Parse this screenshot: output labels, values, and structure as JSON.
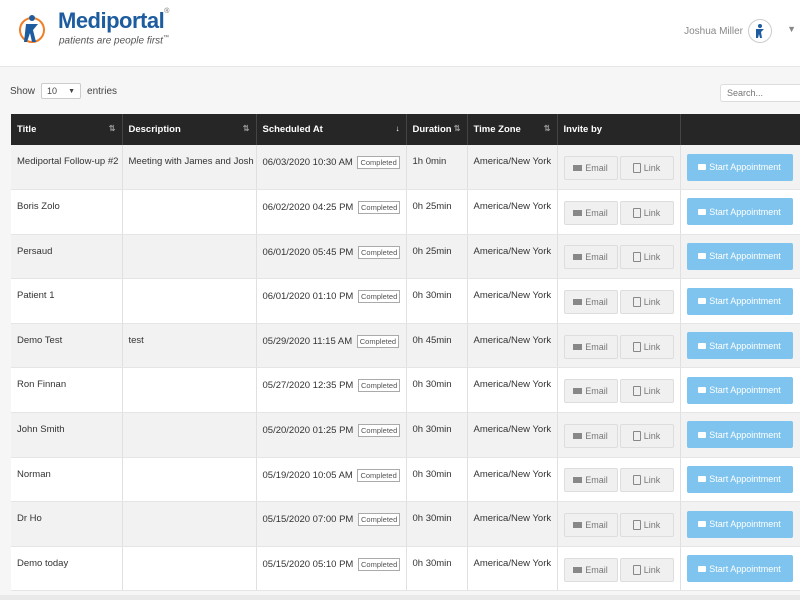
{
  "brand": {
    "name": "Mediportal",
    "trademark": "®",
    "tagline": "patients are people first",
    "tagline_tm": "™",
    "color": "#1d5c9e"
  },
  "user": {
    "name": "Joshua Miller"
  },
  "controls": {
    "show_label": "Show",
    "entries_value": "10",
    "entries_label": "entries",
    "search_placeholder": "Search..."
  },
  "table": {
    "columns": [
      "Title",
      "Description",
      "Scheduled At",
      "Duration",
      "Time Zone",
      "Invite by",
      ""
    ],
    "email_label": "Email",
    "link_label": "Link",
    "start_label": "Start Appointment",
    "status_label": "Completed",
    "rows": [
      {
        "title": "Mediportal Follow-up #2",
        "description": "Meeting with James and Josh",
        "scheduled": "06/03/2020 10:30 AM",
        "duration": "1h 0min",
        "timezone": "America/New York"
      },
      {
        "title": "Boris Zolo",
        "description": "",
        "scheduled": "06/02/2020 04:25 PM",
        "duration": "0h 25min",
        "timezone": "America/New York"
      },
      {
        "title": "Persaud",
        "description": "",
        "scheduled": "06/01/2020 05:45 PM",
        "duration": "0h 25min",
        "timezone": "America/New York"
      },
      {
        "title": "Patient 1",
        "description": "",
        "scheduled": "06/01/2020 01:10 PM",
        "duration": "0h 30min",
        "timezone": "America/New York"
      },
      {
        "title": "Demo Test",
        "description": "test",
        "scheduled": "05/29/2020 11:15 AM",
        "duration": "0h 45min",
        "timezone": "America/New York"
      },
      {
        "title": "Ron Finnan",
        "description": "",
        "scheduled": "05/27/2020 12:35 PM",
        "duration": "0h 30min",
        "timezone": "America/New York"
      },
      {
        "title": "John Smith",
        "description": "",
        "scheduled": "05/20/2020 01:25 PM",
        "duration": "0h 30min",
        "timezone": "America/New York"
      },
      {
        "title": "Norman",
        "description": "",
        "scheduled": "05/19/2020 10:05 AM",
        "duration": "0h 30min",
        "timezone": "America/New York"
      },
      {
        "title": "Dr Ho",
        "description": "",
        "scheduled": "05/15/2020 07:00 PM",
        "duration": "0h 30min",
        "timezone": "America/New York"
      },
      {
        "title": "Demo today",
        "description": "",
        "scheduled": "05/15/2020 05:10 PM",
        "duration": "0h 30min",
        "timezone": "America/New York"
      }
    ]
  },
  "colors": {
    "header_bg": "#262626",
    "start_button": "#7fc4ee"
  }
}
